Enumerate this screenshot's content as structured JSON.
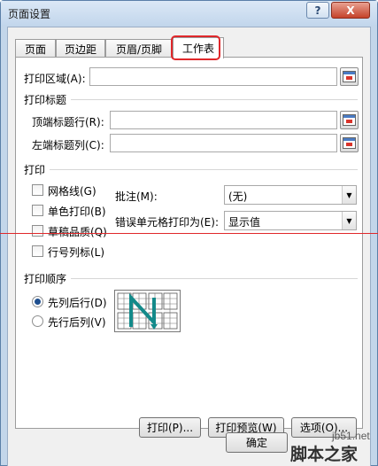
{
  "window": {
    "title": "页面设置",
    "help_label": "?",
    "close_label": "X"
  },
  "tabs": [
    {
      "label": "页面",
      "active": false
    },
    {
      "label": "页边距",
      "active": false
    },
    {
      "label": "页眉/页脚",
      "active": false
    },
    {
      "label": "工作表",
      "active": true
    }
  ],
  "print_area": {
    "label": "打印区域(A):",
    "value": ""
  },
  "print_titles": {
    "section": "打印标题",
    "rows_label": "顶端标题行(R):",
    "rows_value": "",
    "cols_label": "左端标题列(C):",
    "cols_value": ""
  },
  "print": {
    "section": "打印",
    "options": [
      {
        "label": "网格线(G)",
        "checked": false
      },
      {
        "label": "单色打印(B)",
        "checked": false
      },
      {
        "label": "草稿品质(Q)",
        "checked": false
      },
      {
        "label": "行号列标(L)",
        "checked": false
      }
    ],
    "comments_label": "批注(M):",
    "comments_value": "(无)",
    "errors_label": "错误单元格打印为(E):",
    "errors_value": "显示值"
  },
  "page_order": {
    "section": "打印顺序",
    "options": [
      {
        "label": "先列后行(D)",
        "selected": true
      },
      {
        "label": "先行后列(V)",
        "selected": false
      }
    ]
  },
  "buttons": {
    "print": "打印(P)...",
    "preview": "打印预览(W)",
    "options": "选项(O)...",
    "ok": "确定"
  },
  "watermark": {
    "url": "jb51.net",
    "logo": "脚本之家"
  }
}
